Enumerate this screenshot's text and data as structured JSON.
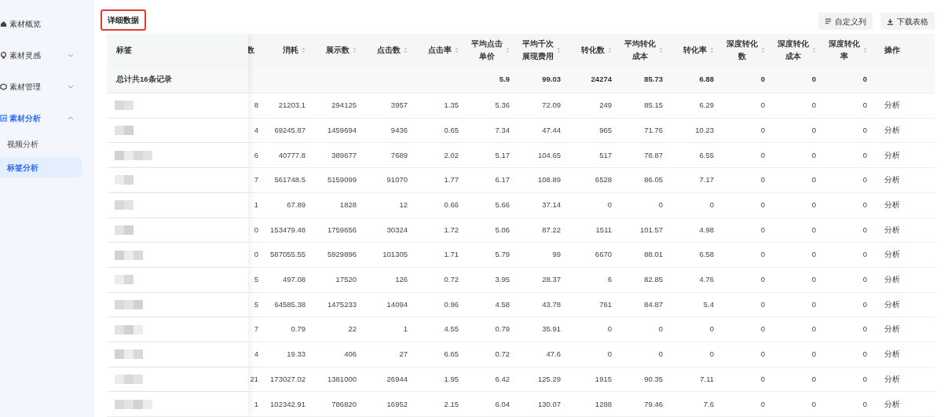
{
  "sidebar": {
    "items": [
      {
        "label": "素材概览",
        "selected": false
      },
      {
        "label": "素材灵感",
        "expanded": false,
        "selected": false
      },
      {
        "label": "素材管理",
        "expanded": false,
        "selected": false
      },
      {
        "label": "素材分析",
        "expanded": true,
        "selected": true,
        "children": [
          {
            "label": "视频分析",
            "selected": false
          },
          {
            "label": "标签分析",
            "selected": true
          }
        ]
      }
    ]
  },
  "section": {
    "title": "详细数据",
    "buttons": [
      {
        "label": "自定义列"
      },
      {
        "label": "下载表格"
      }
    ]
  },
  "table": {
    "columns": [
      {
        "label": "标签",
        "sortable": false
      },
      {
        "label": "数",
        "sortable": false
      },
      {
        "label": "消耗",
        "sortable": true
      },
      {
        "label": "展示数",
        "sortable": true
      },
      {
        "label": "点击数",
        "sortable": true
      },
      {
        "label": "点击率",
        "sortable": true
      },
      {
        "label": "平均点击单价",
        "sortable": true
      },
      {
        "label": "平均千次展现费用",
        "sortable": true
      },
      {
        "label": "转化数",
        "sortable": true
      },
      {
        "label": "平均转化成本",
        "sortable": true
      },
      {
        "label": "转化率",
        "sortable": true
      },
      {
        "label": "深度转化数",
        "sortable": true
      },
      {
        "label": "深度转化成本",
        "sortable": true
      },
      {
        "label": "深度转化率",
        "sortable": true
      },
      {
        "label": "操作",
        "sortable": false
      }
    ],
    "summary": {
      "cells": [
        "总计共16条记录",
        null,
        null,
        null,
        null,
        null,
        "5.9",
        "99.03",
        "24274",
        "85.73",
        "6.88",
        "0",
        "0",
        "0"
      ]
    },
    "rows": [
      {
        "cells": [
          "",
          "8",
          "21203.1",
          "294125",
          "3957",
          "1.35",
          "5.36",
          "72.09",
          "249",
          "85.15",
          "6.29",
          "0",
          "0",
          "0"
        ],
        "action": "分析"
      },
      {
        "cells": [
          "",
          "4",
          "69245.87",
          "1459694",
          "9436",
          "0.65",
          "7.34",
          "47.44",
          "965",
          "71.76",
          "10.23",
          "0",
          "0",
          "0"
        ],
        "action": "分析"
      },
      {
        "cells": [
          "",
          "6",
          "40777.8",
          "389677",
          "7689",
          "2.02",
          "5.17",
          "104.65",
          "517",
          "78.87",
          "6.55",
          "0",
          "0",
          "0"
        ],
        "action": "分析"
      },
      {
        "cells": [
          "",
          "7",
          "561748.5",
          "5159099",
          "91070",
          "1.77",
          "6.17",
          "108.89",
          "6528",
          "86.05",
          "7.17",
          "0",
          "0",
          "0"
        ],
        "action": "分析"
      },
      {
        "cells": [
          "",
          "1",
          "67.89",
          "1828",
          "12",
          "0.66",
          "5.66",
          "37.14",
          "0",
          "0",
          "0",
          "0",
          "0",
          "0"
        ],
        "action": "分析"
      },
      {
        "cells": [
          "",
          "0",
          "153479.48",
          "1759656",
          "30324",
          "1.72",
          "5.06",
          "87.22",
          "1511",
          "101.57",
          "4.98",
          "0",
          "0",
          "0"
        ],
        "action": "分析"
      },
      {
        "cells": [
          "",
          "0",
          "587055.55",
          "5929896",
          "101305",
          "1.71",
          "5.79",
          "99",
          "6670",
          "88.01",
          "6.58",
          "0",
          "0",
          "0"
        ],
        "action": "分析"
      },
      {
        "cells": [
          "",
          "5",
          "497.08",
          "17520",
          "126",
          "0.72",
          "3.95",
          "28.37",
          "6",
          "82.85",
          "4.76",
          "0",
          "0",
          "0"
        ],
        "action": "分析"
      },
      {
        "cells": [
          "",
          "5",
          "64585.38",
          "1475233",
          "14094",
          "0.96",
          "4.58",
          "43.78",
          "761",
          "84.87",
          "5.4",
          "0",
          "0",
          "0"
        ],
        "action": "分析"
      },
      {
        "cells": [
          "",
          "7",
          "0.79",
          "22",
          "1",
          "4.55",
          "0.79",
          "35.91",
          "0",
          "0",
          "0",
          "0",
          "0",
          "0"
        ],
        "action": "分析"
      },
      {
        "cells": [
          "",
          "4",
          "19.33",
          "406",
          "27",
          "6.65",
          "0.72",
          "47.6",
          "0",
          "0",
          "0",
          "0",
          "0",
          "0"
        ],
        "action": "分析"
      },
      {
        "cells": [
          "",
          "21",
          "173027.02",
          "1381000",
          "26944",
          "1.95",
          "6.42",
          "125.29",
          "1915",
          "90.35",
          "7.11",
          "0",
          "0",
          "0"
        ],
        "action": "分析"
      },
      {
        "cells": [
          "",
          "1",
          "102342.91",
          "786820",
          "16952",
          "2.15",
          "6.04",
          "130.07",
          "1288",
          "79.46",
          "7.6",
          "0",
          "0",
          "0"
        ],
        "action": "分析"
      }
    ]
  }
}
